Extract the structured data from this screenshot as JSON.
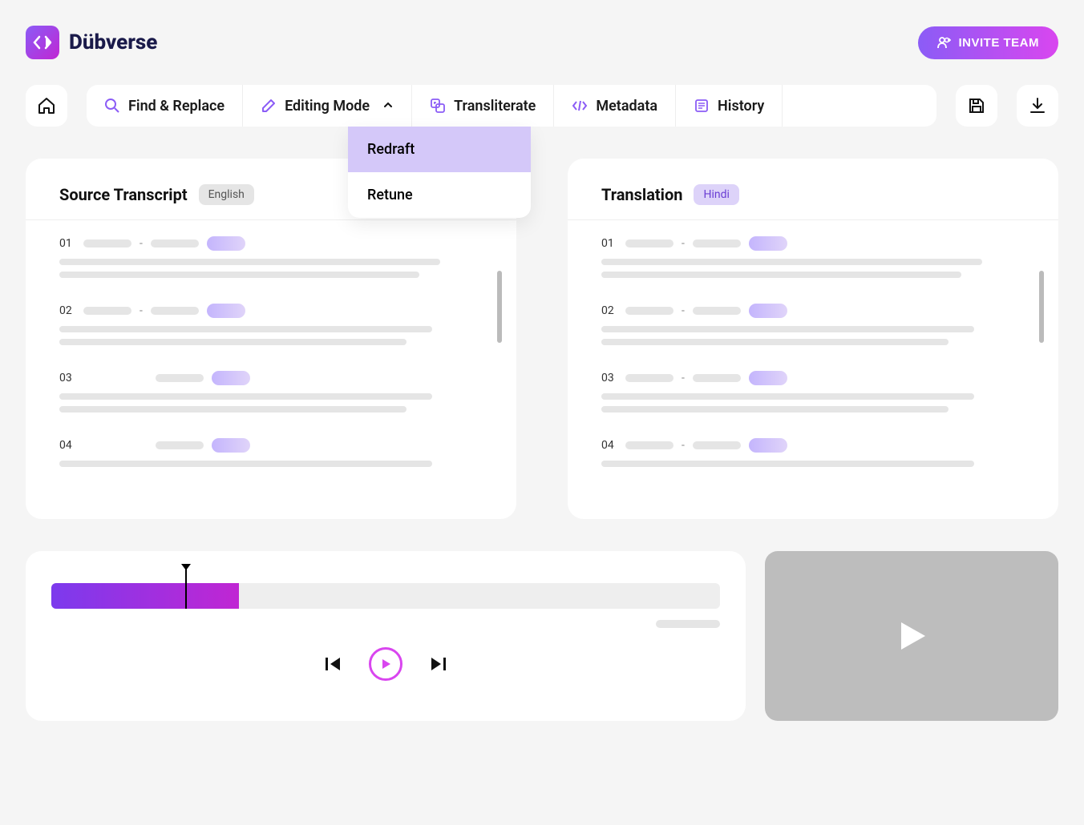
{
  "brand": "Dübverse",
  "header": {
    "invite_label": "INVITE TEAM"
  },
  "toolbar": {
    "find_replace": "Find & Replace",
    "editing_mode": "Editing Mode",
    "transliterate": "Transliterate",
    "metadata": "Metadata",
    "history": "History"
  },
  "editing_mode_menu": {
    "redraft": "Redraft",
    "retune": "Retune"
  },
  "source": {
    "title": "Source Transcript",
    "language": "English",
    "rows": [
      "01",
      "02",
      "03",
      "04"
    ]
  },
  "translation": {
    "title": "Translation",
    "language": "Hindi",
    "rows": [
      "01",
      "02",
      "03",
      "04"
    ]
  }
}
